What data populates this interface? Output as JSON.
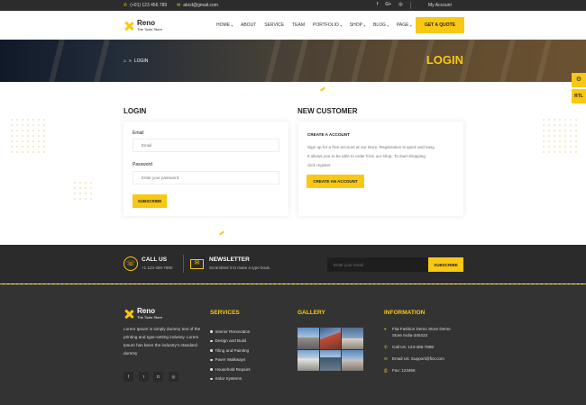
{
  "topbar": {
    "phone": "(+01) 123 456 789",
    "email": "abcd@gmail.com",
    "social_icons": [
      "facebook-icon",
      "google-plus-icon",
      "instagram-icon"
    ],
    "account_label": "My Account"
  },
  "header": {
    "logo": {
      "name": "Reno",
      "tagline": "The Tools Store"
    },
    "nav": [
      {
        "label": "HOME",
        "has_dropdown": true
      },
      {
        "label": "ABOUT",
        "has_dropdown": false
      },
      {
        "label": "SERVICE",
        "has_dropdown": false
      },
      {
        "label": "TEAM",
        "has_dropdown": false
      },
      {
        "label": "PORTFOLIO",
        "has_dropdown": true
      },
      {
        "label": "SHOP",
        "has_dropdown": true
      },
      {
        "label": "BLOG",
        "has_dropdown": true
      },
      {
        "label": "PAGE",
        "has_dropdown": true
      }
    ],
    "quote_button": "GET A QUOTE"
  },
  "banner": {
    "breadcrumb_separator": "»",
    "breadcrumb_current": "LOGIN",
    "title": "LOGIN"
  },
  "side": {
    "rtl_label": "RTL"
  },
  "login": {
    "title": "LOGIN",
    "email_label": "Email",
    "email_placeholder": "Email",
    "password_label": "Password",
    "password_placeholder": "Enter your password",
    "submit_label": "SUBSCRIBE"
  },
  "new_customer": {
    "title": "NEW CUSTOMER",
    "heading": "CREATE A ACCOUNT",
    "text_line1": "Sign up for a free account at our store. Registration is quick and easy.",
    "text_line2": "It allows you to be able to order from our shop. To start shopping",
    "text_line3": "click register.",
    "button": "CREATE AN ACCOUNT"
  },
  "contact_strip": {
    "call_title": "CALL US",
    "call_number": "+1 123-456-7890",
    "newsletter_title": "NEWSLETTER",
    "newsletter_text": "Scrambled it to make a type book.",
    "email_placeholder": "Enter your email",
    "subscribe_label": "SUBSCRIBE"
  },
  "footer": {
    "logo": {
      "name": "Reno",
      "tagline": "The Tools Store"
    },
    "about_text": "Lorem Ipsum is simply dummy text of the printing and type-setting industry. Lorem Ipsum has been the industry's standard dummy",
    "social": [
      {
        "label": "f",
        "icon": "facebook-icon"
      },
      {
        "label": "t",
        "icon": "twitter-icon"
      },
      {
        "label": "G",
        "icon": "google-plus-icon"
      },
      {
        "label": "◎",
        "icon": "instagram-icon"
      }
    ],
    "services_title": "SERVICES",
    "services": [
      "Interior Renovation",
      "Design and Build",
      "Tiling and Painting",
      "Paver Walkways",
      "Household Repairs",
      "Solar Systems"
    ],
    "gallery_title": "GALLERY",
    "information_title": "INFORMATION",
    "address_line1": "Flat Fashion Demo Store Demo",
    "address_line2": "Store India-345423",
    "phone": "Call Us: 123-456-7898",
    "email": "Email Us: Support@fiot.com",
    "fax": "Fax: 123456"
  },
  "colors": {
    "accent": "#f9c814",
    "dark": "#2b2b2b",
    "footer": "#333333"
  }
}
